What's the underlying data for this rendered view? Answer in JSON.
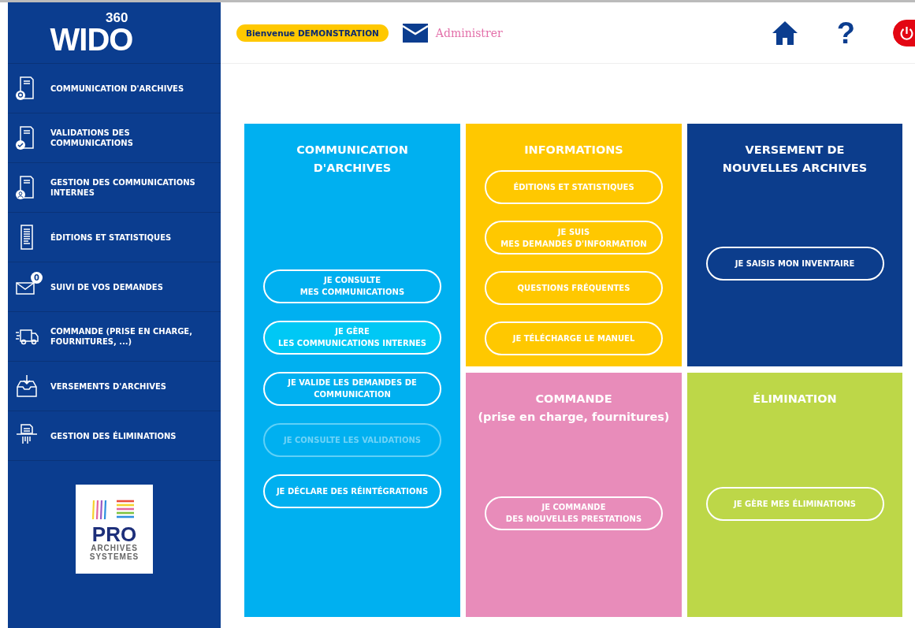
{
  "logo": {
    "name": "WIDO",
    "version": "360"
  },
  "sidebar": {
    "items": [
      {
        "label": "COMMUNICATION D'ARCHIVES"
      },
      {
        "label": "VALIDATIONS DES COMMUNICATIONS"
      },
      {
        "label": "GESTION DES COMMUNICATIONS INTERNES"
      },
      {
        "label": "ÉDITIONS ET STATISTIQUES"
      },
      {
        "label": "SUIVI DE VOS DEMANDES",
        "badge": "0"
      },
      {
        "label": "COMMANDE (PRISE EN CHARGE, FOURNITURES, ...)"
      },
      {
        "label": "VERSEMENTS D'ARCHIVES"
      },
      {
        "label": "GESTION DES ÉLIMINATIONS"
      }
    ],
    "partner_logo": {
      "name": "PRO",
      "line_1": "ARCHIVES",
      "line_2": "SYSTEMES"
    }
  },
  "header": {
    "welcome": "Bienvenue DEMONSTRATION",
    "link": "Administrer",
    "help": "?"
  },
  "tiles": [
    {
      "title": "COMMUNICATION\nD'ARCHIVES",
      "color": "#00b0f0",
      "buttons": [
        {
          "label": "JE CONSULTE\nMES COMMUNICATIONS",
          "highlighted": false,
          "disabled": false
        },
        {
          "label": "JE GÈRE\nLES COMMUNICATIONS INTERNES",
          "highlighted": true,
          "disabled": false
        },
        {
          "label": "JE VALIDE LES DEMANDES DE\nCOMMUNICATION",
          "highlighted": false,
          "disabled": false
        },
        {
          "label": "JE CONSULTE LES VALIDATIONS",
          "highlighted": false,
          "disabled": true
        },
        {
          "label": "JE DÉCLARE DES RÉINTÉGRATIONS",
          "highlighted": false,
          "disabled": false
        }
      ]
    },
    {
      "title": "INFORMATIONS",
      "color": "#ffc800",
      "buttons": [
        {
          "label": "ÉDITIONS ET STATISTIQUES",
          "highlighted": false,
          "disabled": false
        },
        {
          "label": "JE SUIS\nMES DEMANDES D'INFORMATION",
          "highlighted": false,
          "disabled": false
        },
        {
          "label": "QUESTIONS FRÉQUENTES",
          "highlighted": false,
          "disabled": false
        },
        {
          "label": "JE TÉLÉCHARGE LE MANUEL",
          "highlighted": false,
          "disabled": false
        }
      ]
    },
    {
      "title": "VERSEMENT DE\nNOUVELLES ARCHIVES",
      "color": "#0c3d8c",
      "buttons": [
        {
          "label": "JE SAISIS MON INVENTAIRE",
          "highlighted": false,
          "disabled": false
        }
      ]
    },
    {
      "title": "COMMANDE\n(prise en charge, fournitures)",
      "color": "#e88cba",
      "buttons": [
        {
          "label": "JE COMMANDE\nDES NOUVELLES PRESTATIONS",
          "highlighted": false,
          "disabled": false
        }
      ]
    },
    {
      "title": "ÉLIMINATION",
      "color": "#bdd748",
      "buttons": [
        {
          "label": "JE GÈRE MES ÉLIMINATIONS",
          "highlighted": false,
          "disabled": false
        }
      ]
    }
  ]
}
